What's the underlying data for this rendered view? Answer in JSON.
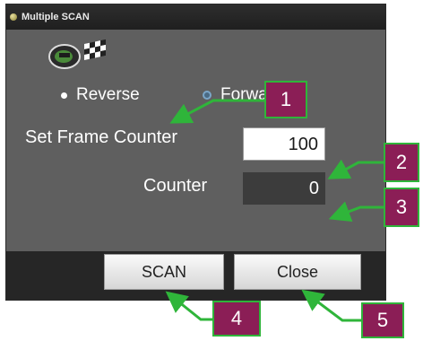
{
  "window": {
    "title": "Multiple SCAN"
  },
  "direction": {
    "options": [
      {
        "label": "Reverse",
        "selected": true
      },
      {
        "label": "Forward",
        "selected": false
      }
    ]
  },
  "set_frame_counter": {
    "label": "Set Frame Counter",
    "value": "100"
  },
  "counter": {
    "label": "Counter",
    "value": "0"
  },
  "buttons": {
    "scan_label": "SCAN",
    "close_label": "Close"
  },
  "callouts": [
    "1",
    "2",
    "3",
    "4",
    "5"
  ],
  "colors": {
    "callout_fill": "#8b1e56",
    "callout_border": "#2fb53a",
    "arrow": "#2fb53a"
  }
}
